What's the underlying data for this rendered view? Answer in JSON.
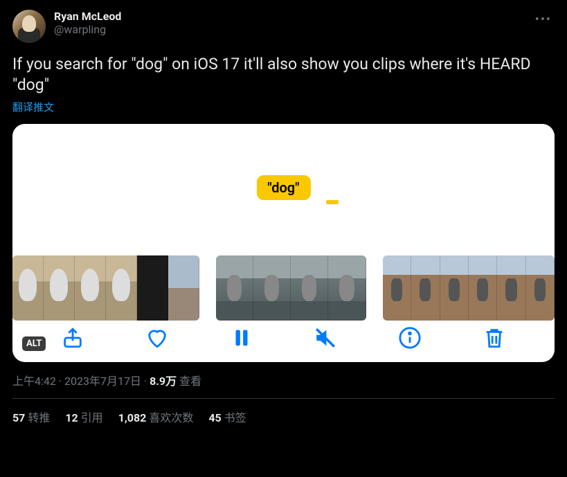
{
  "author": {
    "display_name": "Ryan McLeod",
    "handle": "@warpling"
  },
  "tweet_text": "If you search for \"dog\" on iOS 17 it'll also show you clips where it's HEARD \"dog\"",
  "translate_label": "翻译推文",
  "media": {
    "search_term": "\"dog\"",
    "alt_badge": "ALT"
  },
  "meta": {
    "time": "上午4:42",
    "date": "2023年7月17日",
    "views_number": "8.9万",
    "views_label": "查看"
  },
  "stats": {
    "retweets_count": "57",
    "retweets_label": "转推",
    "quotes_count": "12",
    "quotes_label": "引用",
    "likes_count": "1,082",
    "likes_label": "喜欢次数",
    "bookmarks_count": "45",
    "bookmarks_label": "书签"
  }
}
